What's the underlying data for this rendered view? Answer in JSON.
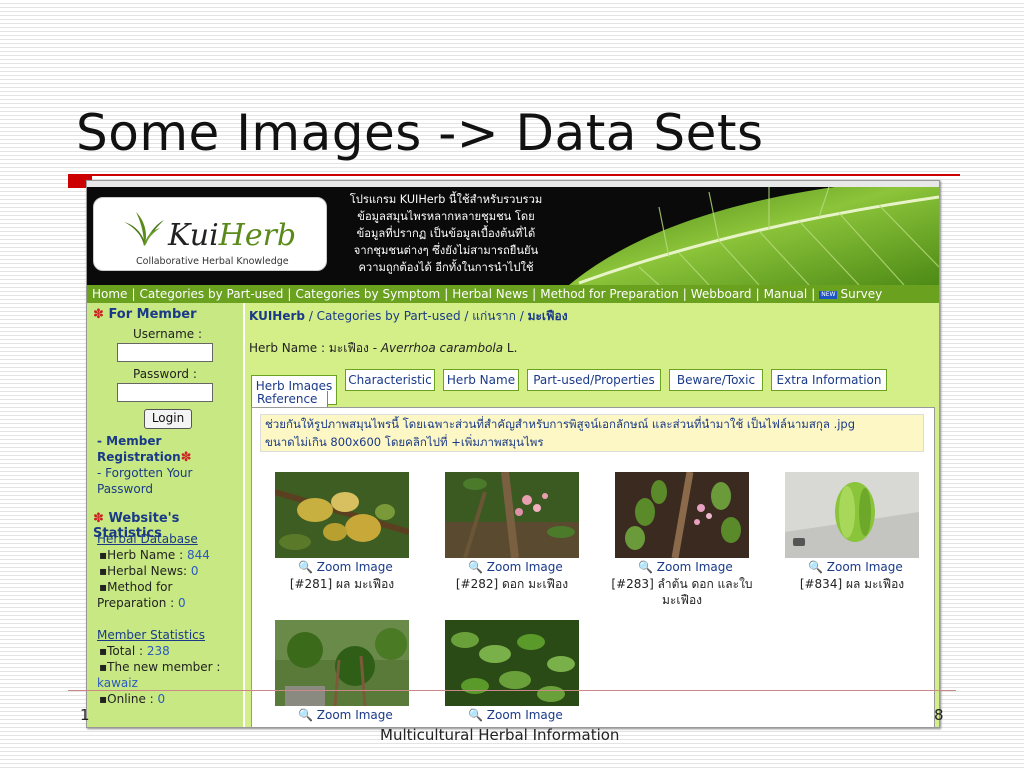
{
  "slide": {
    "title": "Some Images -> Data Sets",
    "footer_left": "1",
    "footer_center": "Multicultural Herbal Information",
    "footer_right": "8",
    "accent": "#cc0000"
  },
  "site": {
    "logo_main": "Kui",
    "logo_green": "Herb",
    "logo_sub": "Collaborative Herbal Knowledge",
    "banner_lines": [
      "โปรแกรม KUIHerb นี้ใช้สำหรับรวบรวม",
      "ข้อมูลสมุนไพรหลากหลายชุมชน โดย",
      "ข้อมูลที่ปรากฏ เป็นข้อมูลเบื้องต้นที่ได้",
      "จากชุมชนต่างๆ ซึ่งยังไม่สามารถยืนยัน",
      "ความถูกต้องได้ อีกทั้งในการนำไปใช้"
    ]
  },
  "nav": {
    "items": [
      "Home",
      "Categories by Part-used",
      "Categories by Symptom",
      "Herbal News",
      "Method for Preparation",
      "Webboard",
      "Manual"
    ],
    "new_badge": "NEW",
    "survey": "Survey"
  },
  "sidebar": {
    "member_heading": "For Member",
    "username_label": "Username :",
    "password_label": "Password :",
    "login_button": "Login",
    "member_link": "- Member",
    "registration_link": "Registration",
    "forgot_line1": "- Forgotten Your",
    "forgot_line2": "Password",
    "stats_heading": "Website's Statistics",
    "herbal_db_heading": "Herbal Database",
    "herb_name_label": "Herb Name : ",
    "herb_name_value": "844",
    "herbal_news_label": "Herbal News: ",
    "herbal_news_value": "0",
    "method_label1": "Method for",
    "method_label2": "Preparation : ",
    "method_value": "0",
    "member_stats_heading": "Member Statistics",
    "total_label": "Total : ",
    "total_value": "238",
    "new_member_label": "The new member :",
    "new_member_value": "kawaiz",
    "online_label": "Online : ",
    "online_value": "0"
  },
  "breadcrumb": {
    "site": "KUIHerb",
    "sep": " / ",
    "category": "Categories by Part-used",
    "sub": "แก่นราก",
    "current": "มะเฟือง"
  },
  "herb": {
    "label": "Herb Name : ",
    "thai": "มะเฟือง - ",
    "latin": "Averrhoa carambola",
    "author": " L."
  },
  "tabs": [
    "Herb Images",
    "Characteristic",
    "Herb Name",
    "Part-used/Properties",
    "Beware/Toxic",
    "Extra Information"
  ],
  "tab_second_row": "Reference",
  "note": {
    "line1": "ช่วยกันให้รูปภาพสมุนไพรนี้ โดยเฉพาะส่วนที่สำคัญสำหรับการพิสูจน์เอกลักษณ์ และส่วนที่นำมาใช้ เป็นไฟล์นามสกุล .jpg",
    "line2": "ขนาดไม่เกิน 800x600 โดยคลิกไปที่ +เพิ่มภาพสมุนไพร"
  },
  "images": [
    {
      "zoom": "Zoom Image",
      "caption": "[#281] ผล มะเฟือง"
    },
    {
      "zoom": "Zoom Image",
      "caption": "[#282] ดอก มะเฟือง"
    },
    {
      "zoom": "Zoom Image",
      "caption": "[#283] ลำต้น ดอก และใบ มะเฟือง"
    },
    {
      "zoom": "Zoom Image",
      "caption": "[#834] ผล มะเฟือง"
    },
    {
      "zoom": "Zoom Image",
      "caption": ""
    },
    {
      "zoom": "Zoom Image",
      "caption": ""
    }
  ]
}
